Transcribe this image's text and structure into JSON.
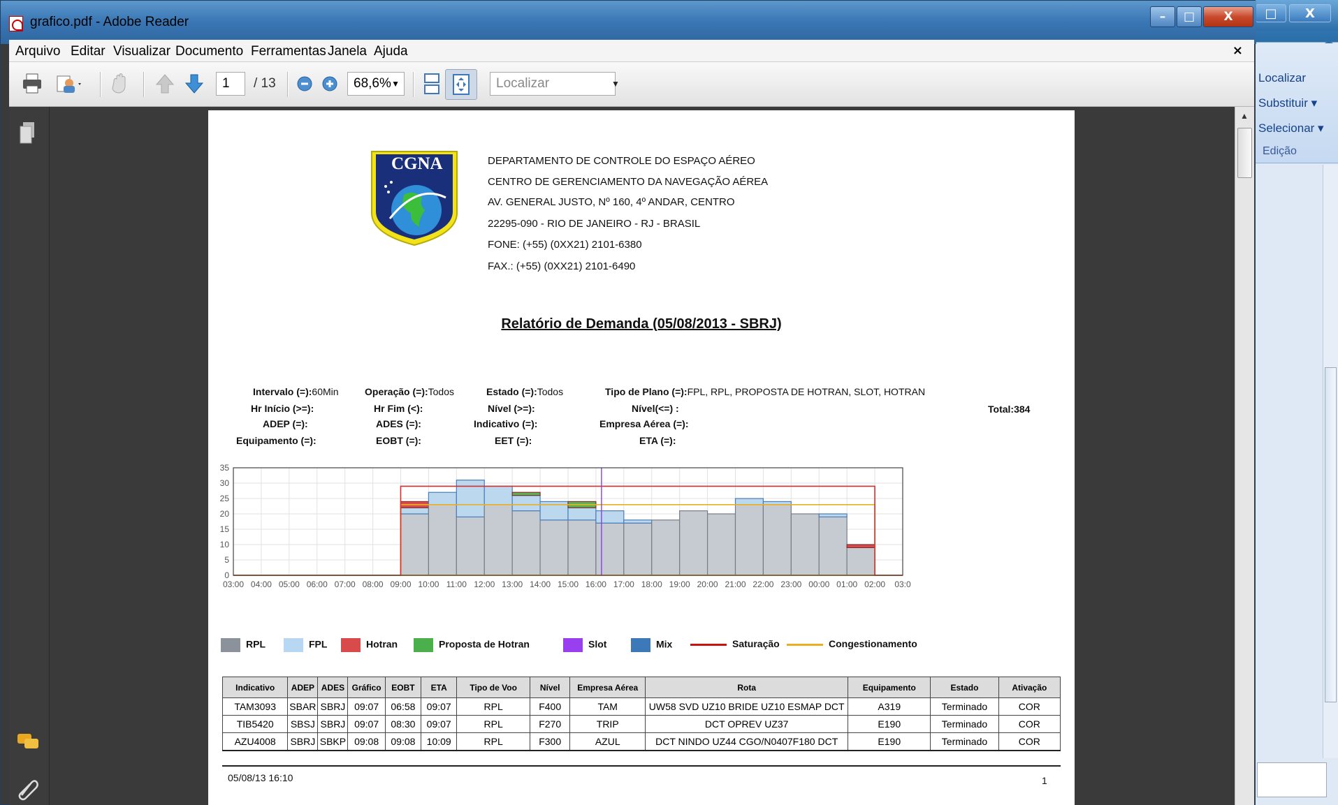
{
  "window": {
    "title": "grafico.pdf - Adobe Reader",
    "min_glyph": "–",
    "max_glyph": "□",
    "close_glyph": "X"
  },
  "menu": [
    "Arquivo",
    "Editar",
    "Visualizar",
    "Documento",
    "Ferramentas",
    "Janela",
    "Ajuda"
  ],
  "menu_close": "×",
  "toolbar": {
    "page_current": "1",
    "page_total": "/ 13",
    "zoom": "68,6%",
    "find_placeholder": "Localizar"
  },
  "side_window": {
    "buttons": [
      "□",
      "X"
    ],
    "help": "?",
    "items": [
      "Localizar",
      "Substituir ▾",
      "Selecionar ▾"
    ],
    "group": "Edição"
  },
  "document": {
    "logo_text": "CGNA",
    "header_lines": [
      "DEPARTAMENTO DE CONTROLE DO ESPAÇO AÉREO",
      "CENTRO DE GERENCIAMENTO DA NAVEGAÇÃO AÉREA",
      "AV. GENERAL JUSTO, Nº 160, 4º ANDAR, CENTRO",
      "22295-090 - RIO DE JANEIRO - RJ - BRASIL",
      "FONE: (+55) (0XX21) 2101-6380",
      "FAX.: (+55) (0XX21) 2101-6490"
    ],
    "report_title": "Relatório de Demanda (05/08/2013 - SBRJ)",
    "filters": [
      [
        "Intervalo (=):",
        "60Min"
      ],
      [
        "Operação (=):",
        "Todos"
      ],
      [
        "Estado (=):",
        "Todos"
      ],
      [
        "Tipo de Plano (=):",
        "FPL, RPL, PROPOSTA DE HOTRAN, SLOT, HOTRAN"
      ],
      [
        "Hr Início (>=):",
        ""
      ],
      [
        "Hr Fim (<):",
        ""
      ],
      [
        "Nível (>=):",
        ""
      ],
      [
        "Nível(<=) :",
        ""
      ],
      [
        "ADEP (=):",
        ""
      ],
      [
        "ADES (=):",
        ""
      ],
      [
        "Indicativo (=):",
        ""
      ],
      [
        "Empresa Aérea (=):",
        ""
      ],
      [
        "Equipamento (=):",
        ""
      ],
      [
        "EOBT (=):",
        ""
      ],
      [
        "EET (=):",
        ""
      ],
      [
        "ETA (=):",
        ""
      ]
    ],
    "total": "Total:384",
    "legend": [
      {
        "label": "RPL",
        "kind": "box",
        "color": "#8c929c"
      },
      {
        "label": "FPL",
        "kind": "box",
        "color": "#b7d7f2"
      },
      {
        "label": "Hotran",
        "kind": "box",
        "color": "#d94b4b"
      },
      {
        "label": "Proposta de Hotran",
        "kind": "box",
        "color": "#4bb04b"
      },
      {
        "label": "Slot",
        "kind": "box",
        "color": "#9a3ff0"
      },
      {
        "label": "Mix",
        "kind": "box",
        "color": "#3d79b8"
      },
      {
        "label": "Saturação",
        "kind": "line",
        "color": "#cc1111"
      },
      {
        "label": "Congestionamento",
        "kind": "line",
        "color": "#e8b020"
      }
    ],
    "table": {
      "headers": [
        "Indicativo",
        "ADEP",
        "ADES",
        "Gráfico",
        "EOBT",
        "ETA",
        "Tipo de Voo",
        "Nível",
        "Empresa Aérea",
        "Rota",
        "Equipamento",
        "Estado",
        "Ativação"
      ],
      "rows": [
        [
          "TAM3093",
          "SBAR",
          "SBRJ",
          "09:07",
          "06:58",
          "09:07",
          "RPL",
          "F400",
          "TAM",
          "UW58 SVD UZ10 BRIDE UZ10 ESMAP DCT",
          "A319",
          "Terminado",
          "COR"
        ],
        [
          "TIB5420",
          "SBSJ",
          "SBRJ",
          "09:07",
          "08:30",
          "09:07",
          "RPL",
          "F270",
          "TRIP",
          "DCT OPREV UZ37",
          "E190",
          "Terminado",
          "COR"
        ],
        [
          "AZU4008",
          "SBRJ",
          "SBKP",
          "09:08",
          "09:08",
          "10:09",
          "RPL",
          "F300",
          "AZUL",
          "DCT NINDO UZ44 CGO/N0407F180 DCT",
          "E190",
          "Terminado",
          "COR"
        ]
      ]
    },
    "footer_date": "05/08/13 16:10",
    "footer_page": "1"
  },
  "chart_data": {
    "type": "bar",
    "ylim": [
      0,
      35
    ],
    "yticks": [
      0,
      5,
      10,
      15,
      20,
      25,
      30,
      35
    ],
    "x_ticks": [
      "03:00",
      "04:00",
      "05:00",
      "06:00",
      "07:00",
      "08:00",
      "09:00",
      "10:00",
      "11:00",
      "12:00",
      "13:00",
      "14:00",
      "15:00",
      "16:00",
      "17:00",
      "18:00",
      "19:00",
      "20:00",
      "21:00",
      "22:00",
      "23:00",
      "00:00",
      "01:00",
      "02:00",
      "03:0"
    ],
    "grid": true,
    "series": [
      {
        "name": "RPL",
        "color": "#c6cbd2",
        "values": [
          0,
          0,
          0,
          0,
          0,
          0,
          20,
          23,
          19,
          23,
          21,
          18,
          18,
          17,
          17,
          18,
          21,
          20,
          23,
          23,
          20,
          19,
          9,
          0
        ]
      },
      {
        "name": "FPL",
        "color": "#bcd8ee",
        "values": [
          0,
          0,
          0,
          0,
          0,
          0,
          2,
          4,
          12,
          6,
          5,
          6,
          4,
          4,
          1,
          0,
          0,
          0,
          2,
          1,
          0,
          1,
          0,
          0
        ]
      },
      {
        "name": "Hotran",
        "color": "#d94b4b",
        "values": [
          0,
          0,
          0,
          0,
          0,
          0,
          2,
          0,
          0,
          0,
          0,
          0,
          0,
          0,
          0,
          0,
          0,
          0,
          0,
          0,
          0,
          0,
          1,
          0
        ]
      },
      {
        "name": "Proposta de Hotran",
        "color": "#56b656",
        "values": [
          0,
          0,
          0,
          0,
          0,
          0,
          0,
          0,
          0,
          0,
          1,
          0,
          2,
          0,
          0,
          0,
          0,
          0,
          0,
          0,
          0,
          0,
          0,
          0
        ]
      }
    ],
    "saturation": {
      "name": "Saturação",
      "value": 29,
      "from_index": 6,
      "to_index": 23
    },
    "congestion": {
      "name": "Congestionamento",
      "value": 23,
      "from_index": 6,
      "to_index": 23
    },
    "slot_marker_index": 13.2
  }
}
